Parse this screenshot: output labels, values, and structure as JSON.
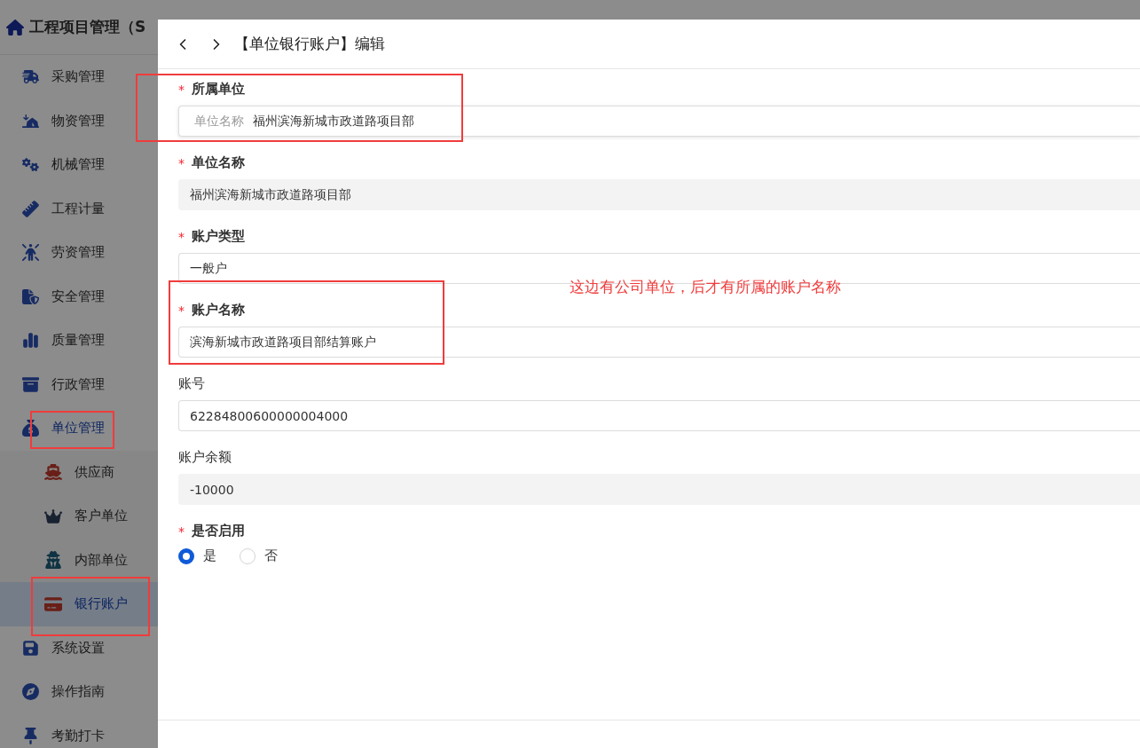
{
  "sidebar": {
    "title": "工程项目管理（S",
    "items": [
      {
        "label": "采购管理",
        "selected": false,
        "expanded": false
      },
      {
        "label": "物资管理",
        "selected": false,
        "expanded": false
      },
      {
        "label": "机械管理",
        "selected": false,
        "expanded": false
      },
      {
        "label": "工程计量",
        "selected": false,
        "expanded": false
      },
      {
        "label": "劳资管理",
        "selected": false,
        "expanded": false
      },
      {
        "label": "安全管理",
        "selected": false,
        "expanded": false
      },
      {
        "label": "质量管理",
        "selected": false,
        "expanded": false
      },
      {
        "label": "行政管理",
        "selected": false,
        "expanded": false
      },
      {
        "label": "单位管理",
        "selected": false,
        "expanded": true,
        "children": [
          {
            "label": "供应商",
            "selected": false
          },
          {
            "label": "客户单位",
            "selected": false
          },
          {
            "label": "内部单位",
            "selected": false
          },
          {
            "label": "银行账户",
            "selected": true
          }
        ]
      },
      {
        "label": "系统设置",
        "selected": false,
        "expanded": false
      },
      {
        "label": "操作指南",
        "selected": false,
        "expanded": false
      },
      {
        "label": "考勤打卡",
        "selected": false,
        "expanded": false
      }
    ]
  },
  "drawer": {
    "title": "【单位银行账户】编辑",
    "fields": [
      {
        "kind": "prefixed",
        "label": "所属单位",
        "required_mark": "*",
        "prefix": "单位名称",
        "value": "福州滨海新城市政道路项目部"
      },
      {
        "kind": "disabled",
        "label": "单位名称",
        "required_mark": "*",
        "value": "福州滨海新城市政道路项目部"
      },
      {
        "kind": "text",
        "label": "账户类型",
        "required_mark": "*",
        "value": "一般户"
      },
      {
        "kind": "text",
        "label": "账户名称",
        "required_mark": "*",
        "value": "滨海新城市政道路项目部结算账户"
      },
      {
        "kind": "text",
        "label": "账号",
        "value": "62284800600000004000"
      },
      {
        "kind": "disabled",
        "label": "账户余额",
        "value": "-10000"
      },
      {
        "kind": "radio",
        "label": "是否启用",
        "required_mark": "*",
        "options": [
          {
            "label": "是",
            "selected": true
          },
          {
            "label": "否",
            "selected": false
          }
        ]
      }
    ]
  },
  "annotation": {
    "note": "这边有公司单位，后才有所属的账户名称"
  }
}
